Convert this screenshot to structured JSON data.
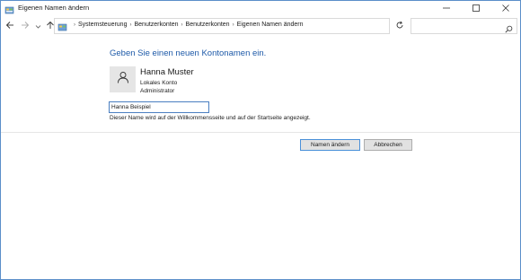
{
  "window": {
    "title": "Eigenen Namen ändern"
  },
  "nav": {
    "breadcrumbs": [
      "Systemsteuerung",
      "Benutzerkonten",
      "Benutzerkonten",
      "Eigenen Namen ändern"
    ],
    "search_placeholder": ""
  },
  "content": {
    "heading": "Geben Sie einen neuen Kontonamen ein.",
    "user": {
      "name": "Hanna Muster",
      "account_type": "Lokales Konto",
      "role": "Administrator"
    },
    "name_input_value": "Hanna Beispiel",
    "hint": "Dieser Name wird auf der Willkommensseite und auf der Startseite angezeigt."
  },
  "buttons": {
    "change_name": "Namen ändern",
    "cancel": "Abbrechen"
  },
  "colors": {
    "heading": "#1e5aa8",
    "window_border": "#5b8ec9",
    "primary_button_border": "#4a90d9"
  }
}
